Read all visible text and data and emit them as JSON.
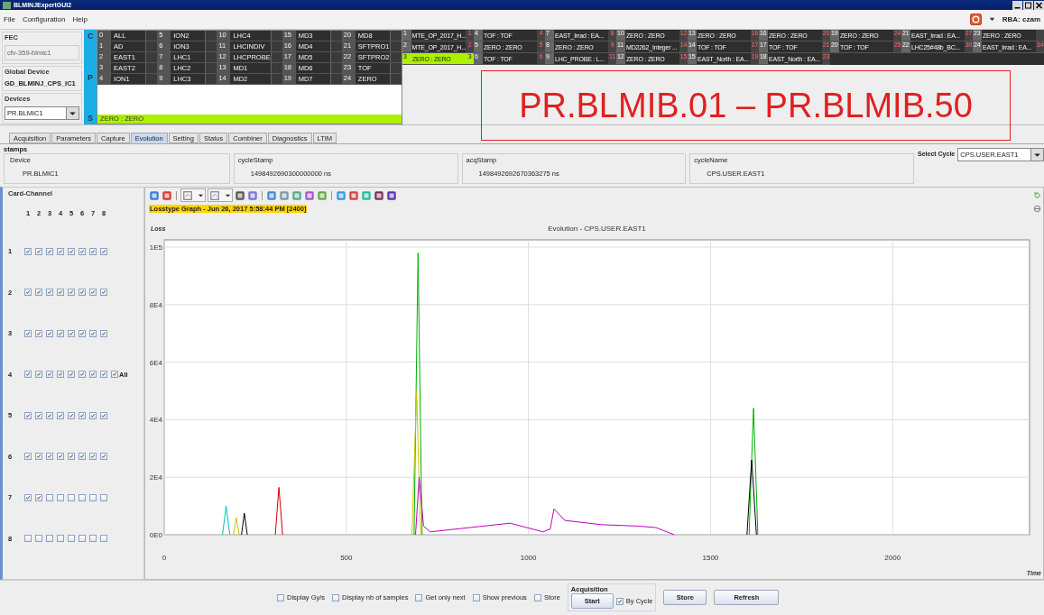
{
  "window": {
    "title": "BLMINJExpertGUI2"
  },
  "menu": [
    "File",
    "Configuration",
    "Help"
  ],
  "user": {
    "label": "RBA: czam"
  },
  "fec": {
    "title": "FEC",
    "value": "cfv-359-blmic1",
    "global_title": "Global Device",
    "global_value": "GD_BLMINJ_CPS_IC1",
    "devices_title": "Devices",
    "device": "PR.BLMIC1"
  },
  "cps_letters": [
    "C",
    "P",
    "S"
  ],
  "users_grid": [
    [
      {
        "n": "0",
        "name": "ALL"
      },
      {
        "n": "1",
        "name": "AD"
      },
      {
        "n": "2",
        "name": "EAST1"
      },
      {
        "n": "3",
        "name": "EAST2"
      },
      {
        "n": "4",
        "name": "ION1"
      }
    ],
    [
      {
        "n": "5",
        "name": "ION2"
      },
      {
        "n": "6",
        "name": "ION3"
      },
      {
        "n": "7",
        "name": "LHC1"
      },
      {
        "n": "8",
        "name": "LHC2"
      },
      {
        "n": "9",
        "name": "LHC3"
      }
    ],
    [
      {
        "n": "10",
        "name": "LHC4"
      },
      {
        "n": "11",
        "name": "LHCINDIV"
      },
      {
        "n": "12",
        "name": "LHCPROBE"
      },
      {
        "n": "13",
        "name": "MD1"
      },
      {
        "n": "14",
        "name": "MD2"
      }
    ],
    [
      {
        "n": "15",
        "name": "MD3"
      },
      {
        "n": "16",
        "name": "MD4"
      },
      {
        "n": "17",
        "name": "MD5"
      },
      {
        "n": "18",
        "name": "MD6"
      },
      {
        "n": "19",
        "name": "MD7"
      }
    ],
    [
      {
        "n": "20",
        "name": "MD8"
      },
      {
        "n": "21",
        "name": "SFTPRO1"
      },
      {
        "n": "22",
        "name": "SFTPRO2"
      },
      {
        "n": "23",
        "name": "TOF"
      },
      {
        "n": "24",
        "name": "ZERO"
      }
    ]
  ],
  "current_user": "ZERO : ZERO",
  "cycles_grid": [
    [
      {
        "n": "1",
        "name": "MTE_OP_2017_H...",
        "r": "1",
        "selected": false
      },
      {
        "n": "2",
        "name": "MTE_OP_2017_H...",
        "r": "2",
        "selected": false
      },
      {
        "n": "3",
        "name": "ZERO : ZERO",
        "r": "3",
        "selected": true
      }
    ],
    [
      {
        "n": "4",
        "name": "TOF : TOF",
        "r": "4",
        "selected": false
      },
      {
        "n": "5",
        "name": "ZERO : ZERO",
        "r": "5",
        "selected": false
      },
      {
        "n": "6",
        "name": "TOF : TOF",
        "r": "6",
        "selected": false
      }
    ],
    [
      {
        "n": "7",
        "name": "EAST_Irrad : EA...",
        "r": "8",
        "selected": false
      },
      {
        "n": "8",
        "name": "ZERO : ZERO",
        "r": "9",
        "selected": false
      },
      {
        "n": "9",
        "name": "LHC_PROBE : L...",
        "r": "11",
        "selected": false
      }
    ],
    [
      {
        "n": "10",
        "name": "ZERO : ZERO",
        "r": "12",
        "selected": false
      },
      {
        "n": "11",
        "name": "MD2262_Integer ...",
        "r": "14",
        "selected": false
      },
      {
        "n": "12",
        "name": "ZERO : ZERO",
        "r": "15",
        "selected": false
      }
    ],
    [
      {
        "n": "13",
        "name": "ZERO : ZERO",
        "r": "16",
        "selected": false
      },
      {
        "n": "14",
        "name": "TOF : TOF",
        "r": "17",
        "selected": false
      },
      {
        "n": "15",
        "name": "EAST_North : EA...",
        "r": "19",
        "selected": false
      }
    ],
    [
      {
        "n": "16",
        "name": "ZERO : ZERO",
        "r": "20",
        "selected": false
      },
      {
        "n": "17",
        "name": "TOF : TOF",
        "r": "21",
        "selected": false
      },
      {
        "n": "18",
        "name": "EAST_North : EA...",
        "r": "23",
        "selected": false
      }
    ],
    [
      {
        "n": "19",
        "name": "ZERO : ZERO",
        "r": "24",
        "selected": false
      },
      {
        "n": "20",
        "name": "TOF : TOF",
        "r": "25",
        "selected": false
      }
    ],
    [
      {
        "n": "21",
        "name": "EAST_Irrad : EA...",
        "r": "27",
        "selected": false
      },
      {
        "n": "22",
        "name": "LHC25#48b_BC...",
        "r": "30",
        "selected": false
      }
    ],
    [
      {
        "n": "23",
        "name": "ZERO : ZERO",
        "selected": false
      },
      {
        "n": "24",
        "name": "EAST_Irrad : EA...",
        "r": "34",
        "selected": false
      }
    ]
  ],
  "annotation": "PR.BLMIB.01 – PR.BLMIB.50",
  "tabs": [
    {
      "label": "Acquisition",
      "selected": false
    },
    {
      "label": "Parameters",
      "selected": false
    },
    {
      "label": "Capture",
      "selected": false
    },
    {
      "label": "Evolution",
      "selected": true
    },
    {
      "label": "Setting",
      "selected": false
    },
    {
      "label": "Status",
      "selected": false
    },
    {
      "label": "Combiner",
      "selected": false
    },
    {
      "label": "Diagnostics",
      "selected": false
    },
    {
      "label": "LTIM",
      "selected": false
    }
  ],
  "stamps": {
    "title": "stamps",
    "fields": [
      {
        "label": "Device",
        "value": "PR.BLMIC1"
      },
      {
        "label": "cycleStamp",
        "value": "1498492690300000000 ns"
      },
      {
        "label": "acqStamp",
        "value": "1498492692670363275 ns"
      },
      {
        "label": "cycleName",
        "value": "CPS.USER.EAST1"
      }
    ]
  },
  "select_cycle": {
    "label": "Select Cycle",
    "value": "CPS.USER.EAST1"
  },
  "card_channel": {
    "title": "Card-Channel",
    "columns": [
      "1",
      "2",
      "3",
      "4",
      "5",
      "6",
      "7",
      "8"
    ],
    "cards": [
      {
        "label": "1",
        "channels": [
          true,
          true,
          true,
          true,
          true,
          true,
          true,
          true
        ]
      },
      {
        "label": "2",
        "channels": [
          true,
          true,
          true,
          true,
          true,
          true,
          true,
          true
        ]
      },
      {
        "label": "3",
        "channels": [
          true,
          true,
          true,
          true,
          true,
          true,
          true,
          true
        ]
      },
      {
        "label": "4",
        "channels": [
          true,
          true,
          true,
          true,
          true,
          true,
          true,
          true
        ],
        "all": {
          "label": "All",
          "checked": true
        }
      },
      {
        "label": "5",
        "channels": [
          true,
          true,
          true,
          true,
          true,
          true,
          true,
          true
        ]
      },
      {
        "label": "6",
        "channels": [
          true,
          true,
          true,
          true,
          true,
          true,
          true,
          true
        ]
      },
      {
        "label": "7",
        "channels": [
          true,
          true,
          false,
          false,
          false,
          false,
          false,
          false
        ]
      },
      {
        "label": "8",
        "channels": [
          false,
          false,
          false,
          false,
          false,
          false,
          false,
          false
        ]
      }
    ]
  },
  "graph_label": "Losstype Graph - Jun 26, 2017 5:58:44 PM [2400]",
  "chart_data": {
    "type": "line",
    "title": "Evolution - CPS.USER.EAST1",
    "xlabel": "Time",
    "ylabel": "Loss",
    "x": [
      160,
      170,
      180,
      190,
      198,
      206,
      212,
      220,
      228,
      305,
      315,
      325,
      680,
      686,
      690,
      693,
      697,
      700,
      704,
      708,
      712,
      730,
      950,
      1040,
      1060,
      1070,
      1100,
      1200,
      1300,
      1350,
      1400,
      1600,
      1606,
      1613,
      1618,
      1626,
      1630
    ],
    "series": [
      {
        "color": "#00b000",
        "values": [
          null,
          null,
          null,
          null,
          null,
          null,
          null,
          null,
          null,
          null,
          null,
          null,
          null,
          0,
          35600,
          62400,
          98000,
          71300,
          35600,
          0,
          null,
          null,
          null,
          null,
          null,
          null,
          null,
          null,
          null,
          null,
          null,
          null,
          0,
          25700,
          44000,
          14700,
          0
        ]
      },
      {
        "color": "#c8c800",
        "values": [
          null,
          null,
          null,
          0,
          6000,
          0,
          null,
          null,
          null,
          null,
          null,
          null,
          0,
          23100,
          38500,
          50000,
          31800,
          18200,
          0,
          null,
          null,
          null,
          null,
          null,
          null,
          null,
          null,
          null,
          null,
          null,
          null,
          null,
          null,
          null,
          null,
          null,
          null
        ]
      },
      {
        "color": "#d00000",
        "values": [
          null,
          null,
          null,
          null,
          null,
          null,
          null,
          null,
          null,
          0,
          16500,
          0,
          null,
          null,
          null,
          null,
          null,
          null,
          null,
          null,
          null,
          null,
          null,
          null,
          null,
          null,
          null,
          null,
          null,
          null,
          null,
          null,
          null,
          null,
          null,
          null,
          null
        ]
      },
      {
        "color": "#c000c0",
        "values": [
          null,
          null,
          null,
          null,
          null,
          null,
          null,
          null,
          null,
          null,
          null,
          null,
          null,
          null,
          0,
          6000,
          14000,
          20000,
          14300,
          8700,
          3000,
          1000,
          4000,
          1000,
          2000,
          9000,
          5000,
          3500,
          3000,
          2500,
          0,
          null,
          null,
          null,
          null,
          null,
          null
        ]
      },
      {
        "color": "#00c0c0",
        "values": [
          0,
          10000,
          0,
          null,
          null,
          null,
          null,
          null,
          null,
          null,
          null,
          null,
          null,
          null,
          null,
          null,
          null,
          null,
          null,
          null,
          null,
          null,
          null,
          null,
          null,
          null,
          null,
          null,
          null,
          null,
          null,
          null,
          null,
          null,
          null,
          null,
          null
        ]
      },
      {
        "color": "#000000",
        "values": [
          null,
          null,
          null,
          null,
          null,
          null,
          0,
          7500,
          0,
          null,
          null,
          null,
          null,
          null,
          null,
          null,
          null,
          null,
          null,
          null,
          null,
          null,
          null,
          null,
          null,
          null,
          null,
          null,
          null,
          null,
          null,
          0,
          12000,
          26000,
          16000,
          0,
          null
        ]
      }
    ],
    "xlim": [
      0,
      2376
    ],
    "ylim": [
      0,
      100000
    ],
    "grid": true,
    "xticks": [
      0,
      500,
      1000,
      1500,
      2000
    ],
    "yticks": [
      {
        "value": 0,
        "label": "0E0"
      },
      {
        "value": 20000,
        "label": "2E4"
      },
      {
        "value": 40000,
        "label": "4E4"
      },
      {
        "value": 60000,
        "label": "6E4"
      },
      {
        "value": 80000,
        "label": "8E4"
      },
      {
        "value": 100000,
        "label": "1E5"
      }
    ]
  },
  "options": [
    {
      "label": "Display Gy/s",
      "checked": false
    },
    {
      "label": "Display nb of samples",
      "checked": false
    },
    {
      "label": "Get only next",
      "checked": false
    },
    {
      "label": "Show previous",
      "checked": false
    },
    {
      "label": "Store",
      "checked": false
    }
  ],
  "acquisition": {
    "title": "Acquisition",
    "start": "Start",
    "by_cycle": {
      "label": "By Cycle",
      "checked": true
    }
  },
  "buttons": [
    "Store",
    "Refresh"
  ]
}
